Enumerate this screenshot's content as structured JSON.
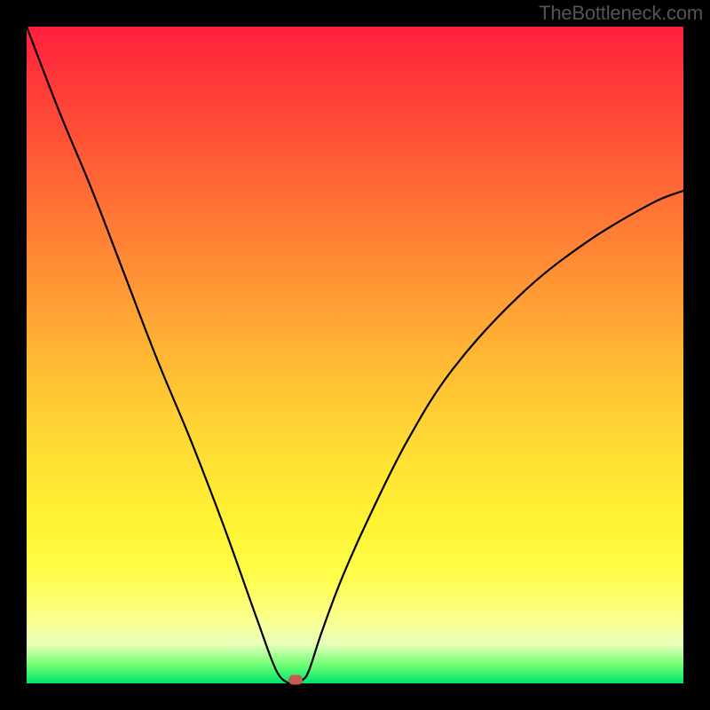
{
  "watermark": "TheBottleneck.com",
  "colors": {
    "frame": "#000000",
    "watermark": "#555555",
    "curve": "#000000",
    "marker": "#c65b55",
    "gradient_top": "#ff1f3c",
    "gradient_bottom": "#00e56a"
  },
  "chart_data": {
    "type": "line",
    "title": "",
    "xlabel": "",
    "ylabel": "",
    "xlim": [
      0,
      100
    ],
    "ylim": [
      0,
      100
    ],
    "series": [
      {
        "name": "bottleneck-curve",
        "x": [
          0,
          5,
          10,
          15,
          20,
          25,
          30,
          35,
          38,
          40,
          41,
          42,
          43,
          45,
          48,
          52,
          58,
          65,
          75,
          85,
          95,
          100
        ],
        "values": [
          100,
          87,
          75,
          62,
          49,
          37,
          24,
          10,
          2,
          0,
          0,
          0.5,
          2,
          8,
          16,
          25,
          37,
          48,
          59,
          67,
          73,
          75
        ]
      }
    ],
    "marker": {
      "x": 41,
      "y": 0.5,
      "name": "optimal-point"
    },
    "annotations": []
  }
}
